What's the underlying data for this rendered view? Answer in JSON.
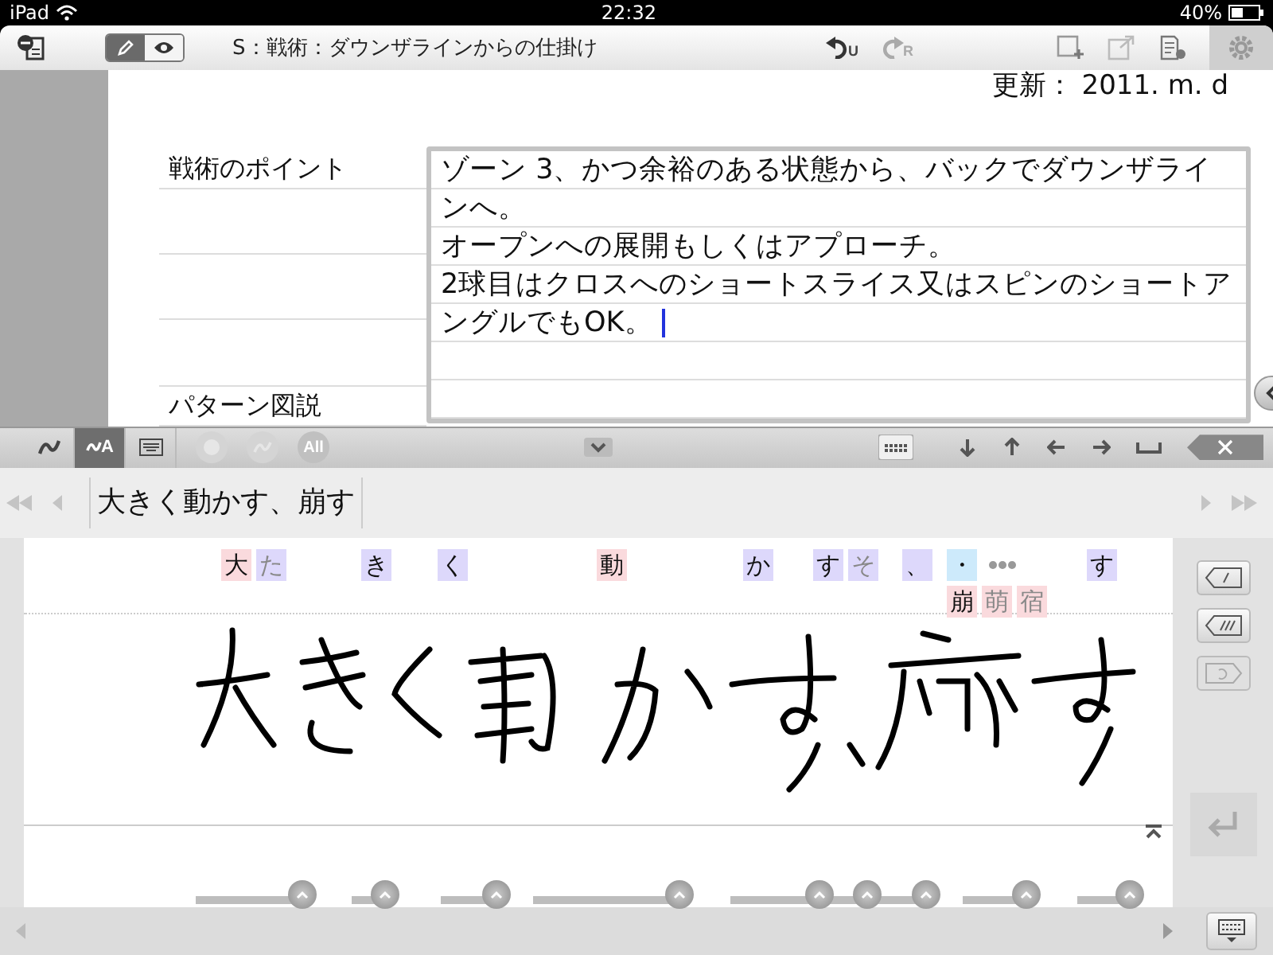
{
  "status_bar": {
    "device": "iPad",
    "time": "22:32",
    "battery": "40%"
  },
  "toolbar": {
    "mode_toggle": [
      {
        "kind": "edit",
        "selected": true
      },
      {
        "kind": "view",
        "selected": false
      }
    ],
    "title": "S：戦術：ダウンザラインからの仕掛け",
    "undo_sub": "U",
    "redo_sub": "R"
  },
  "document": {
    "updated": "更新： 2011. m. d",
    "labels": [
      "戦術のポイント",
      "パターン図説"
    ],
    "paragraphs": [
      "ゾーン 3、かつ余裕のある状態から、バックでダウンザラインへ。",
      "オープンへの展開もしくはアプローチ。",
      "2球目はクロスへのショートスライス又はスピンのショートアングルでもOK。"
    ]
  },
  "input_toolbar": {
    "modes": [
      {
        "kind": "stroke",
        "selected": false
      },
      {
        "kind": "handwrite",
        "selected": true,
        "label": "A"
      },
      {
        "kind": "keyboard",
        "selected": false
      }
    ],
    "all_label": "All"
  },
  "conversion": {
    "text": "大きく動かす、崩す"
  },
  "candidates": [
    {
      "chips": [
        {
          "text": "大",
          "color": "#fadadd",
          "dimmed": false
        },
        {
          "text": "た",
          "color": "#ddd8fb",
          "dimmed": true
        }
      ]
    },
    {
      "chips": [
        {
          "text": "き",
          "color": "#ddd8fb",
          "dimmed": false
        }
      ]
    },
    {
      "chips": [
        {
          "text": "く",
          "color": "#ddd8fb",
          "dimmed": false
        }
      ]
    },
    {
      "chips": [
        {
          "text": "動",
          "color": "#fadadd",
          "dimmed": false
        }
      ]
    },
    {
      "chips": [
        {
          "text": "か",
          "color": "#ddd8fb",
          "dimmed": false
        }
      ]
    },
    {
      "chips": [
        {
          "text": "す",
          "color": "#ddd8fb",
          "dimmed": false
        },
        {
          "text": "そ",
          "color": "#ddd8fb",
          "dimmed": true
        }
      ]
    },
    {
      "chips": [
        {
          "text": "、",
          "color": "#ddd8fb",
          "dimmed": false
        }
      ]
    },
    {
      "chips": [
        {
          "text": "・",
          "color": "#cdeafb",
          "dimmed": false
        }
      ],
      "more": true,
      "alternates": [
        {
          "text": "崩",
          "color": "#fadadd",
          "dimmed": false
        },
        {
          "text": "萌",
          "color": "#fadadd",
          "dimmed": true
        },
        {
          "text": "宿",
          "color": "#fadadd",
          "dimmed": true
        }
      ]
    },
    {
      "chips": [
        {
          "text": "す",
          "color": "#ddd8fb",
          "dimmed": false
        }
      ]
    }
  ]
}
